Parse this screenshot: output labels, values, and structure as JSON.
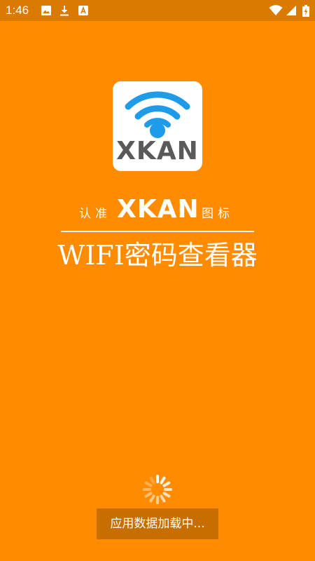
{
  "status_bar": {
    "time": "1:46",
    "left_icons": [
      "image-icon",
      "download-icon",
      "app-notification-icon"
    ],
    "right_icons": [
      "wifi-icon",
      "signal-icon",
      "battery-charging-icon"
    ],
    "color": "#DA7A00"
  },
  "splash": {
    "background_color": "#FF8C00",
    "logo": {
      "icon": "wifi-icon",
      "text": "XKAN",
      "wifi_color": "#1E9BE9",
      "text_color": "#5A5A5A"
    },
    "tagline": {
      "prefix": "认准",
      "brand": "XKAN",
      "suffix": "图标"
    },
    "app_title": "WIFI密码查看器",
    "loading_text": "应用数据加载中..."
  }
}
